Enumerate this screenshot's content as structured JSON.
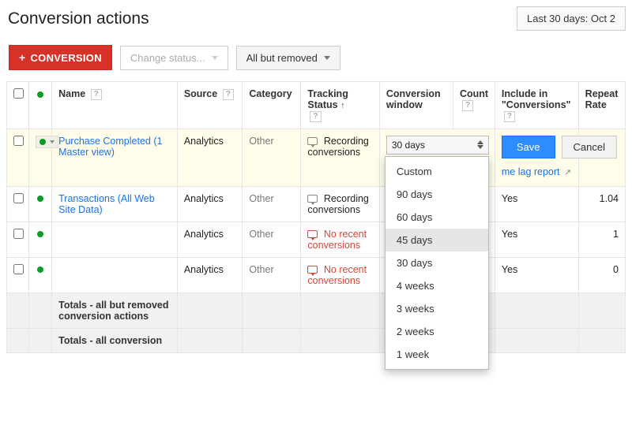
{
  "header": {
    "title": "Conversion actions",
    "date_range": "Last 30 days: Oct 2"
  },
  "toolbar": {
    "conversion_label": "CONVERSION",
    "change_status_label": "Change status...",
    "filter_label": "All but removed"
  },
  "columns": {
    "name": "Name",
    "source": "Source",
    "category": "Category",
    "tracking": "Tracking Status",
    "window": "Conversion window",
    "count": "Count",
    "include": "Include in \"Conversions\"",
    "repeat": "Repeat Rate"
  },
  "rows": [
    {
      "name": "Purchase Completed (1 Master view)",
      "source": "Analytics",
      "category": "Other",
      "tracking": "Recording conversions",
      "tracking_status": "ok",
      "editing": true,
      "window_value": "30 days",
      "include": "",
      "repeat": ""
    },
    {
      "name": "Transactions (All Web Site Data)",
      "source": "Analytics",
      "category": "Other",
      "tracking": "Recording conversions",
      "tracking_status": "ok",
      "include": "Yes",
      "repeat": "1.04"
    },
    {
      "name": "",
      "source": "Analytics",
      "category": "Other",
      "tracking": "No recent conversions",
      "tracking_status": "none",
      "include": "Yes",
      "repeat": "1"
    },
    {
      "name": "",
      "source": "Analytics",
      "category": "Other",
      "tracking": "No recent conversions",
      "tracking_status": "none",
      "include": "Yes",
      "repeat": "0"
    }
  ],
  "dropdown": {
    "options": [
      "Custom",
      "90 days",
      "60 days",
      "45 days",
      "30 days",
      "4 weeks",
      "3 weeks",
      "2 weeks",
      "1 week"
    ],
    "highlighted": "45 days"
  },
  "actions": {
    "save": "Save",
    "cancel": "Cancel",
    "time_lag": "me lag report"
  },
  "totals": {
    "row1": "Totals - all but removed conversion actions",
    "row2": "Totals - all conversion"
  }
}
